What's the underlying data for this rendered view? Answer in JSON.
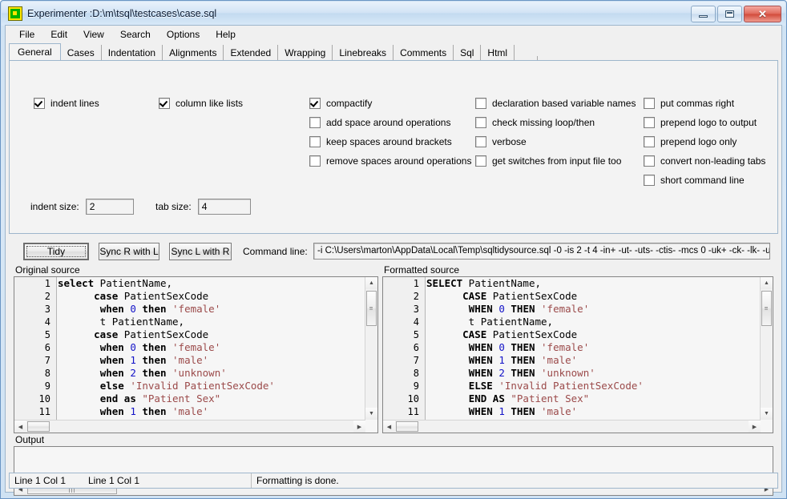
{
  "window": {
    "title": "Experimenter :D:\\m\\tsql\\testcases\\case.sql",
    "icon": "app-icon",
    "minimize_label": "",
    "maximize_label": "",
    "close_label": "✕"
  },
  "menu": {
    "items": [
      "File",
      "Edit",
      "View",
      "Search",
      "Options",
      "Help"
    ]
  },
  "tabs": {
    "active": "General",
    "items": [
      "General",
      "Cases",
      "Indentation",
      "Alignments",
      "Extended",
      "Wrapping",
      "Linebreaks",
      "Comments",
      "Sql",
      "Html"
    ]
  },
  "options": {
    "col1": [
      {
        "label": "indent lines",
        "checked": true
      }
    ],
    "col2": [
      {
        "label": "column like lists",
        "checked": true
      }
    ],
    "col3": [
      {
        "label": "compactify",
        "checked": true
      },
      {
        "label": "add space around operations",
        "checked": false
      },
      {
        "label": "keep spaces around brackets",
        "checked": false
      },
      {
        "label": "remove spaces around operations",
        "checked": false
      }
    ],
    "col4": [
      {
        "label": "declaration based variable names",
        "checked": false
      },
      {
        "label": "check missing loop/then",
        "checked": false
      },
      {
        "label": "verbose",
        "checked": false
      },
      {
        "label": "get switches from input file  too",
        "checked": false
      }
    ],
    "col5": [
      {
        "label": "put commas right",
        "checked": false
      },
      {
        "label": "prepend logo to output",
        "checked": false
      },
      {
        "label": "prepend logo only",
        "checked": false
      },
      {
        "label": "convert non-leading tabs",
        "checked": false
      },
      {
        "label": "short command line",
        "checked": false
      }
    ],
    "indent_size_label": "indent size:",
    "indent_size_value": "2",
    "tab_size_label": "tab size:",
    "tab_size_value": "4"
  },
  "toolbar": {
    "tidy_label": "Tidy",
    "sync_r_with_l_label": "Sync R with L",
    "sync_l_with_r_label": "Sync L with R",
    "command_line_label": "Command line:",
    "command_line_value": "-i C:\\Users\\marton\\AppData\\Local\\Temp\\sqltidysource.sql -0 -is 2 -t 4 -in+ -ut- -uts- -ctis- -mcs 0 -uk+ -ck- -lk- -ui- -c"
  },
  "panes": {
    "original_caption": "Original source",
    "formatted_caption": "Formatted source",
    "original": {
      "line_numbers": [
        "1",
        "2",
        "3",
        "4",
        "5",
        "6",
        "7",
        "8",
        "9",
        "10",
        "11"
      ],
      "lines": [
        [
          {
            "t": "select",
            "c": "kw"
          },
          {
            "t": " PatientName,",
            "c": "pln"
          }
        ],
        [
          {
            "t": "      ",
            "c": "pln"
          },
          {
            "t": "case",
            "c": "kw"
          },
          {
            "t": " PatientSexCode",
            "c": "pln"
          }
        ],
        [
          {
            "t": "       ",
            "c": "pln"
          },
          {
            "t": "when",
            "c": "kw"
          },
          {
            "t": " ",
            "c": "pln"
          },
          {
            "t": "0",
            "c": "num"
          },
          {
            "t": " ",
            "c": "pln"
          },
          {
            "t": "then",
            "c": "kw"
          },
          {
            "t": " ",
            "c": "pln"
          },
          {
            "t": "'female'",
            "c": "str"
          }
        ],
        [
          {
            "t": "       t PatientName,",
            "c": "pln"
          }
        ],
        [
          {
            "t": "      ",
            "c": "pln"
          },
          {
            "t": "case",
            "c": "kw"
          },
          {
            "t": " PatientSexCode",
            "c": "pln"
          }
        ],
        [
          {
            "t": "       ",
            "c": "pln"
          },
          {
            "t": "when",
            "c": "kw"
          },
          {
            "t": " ",
            "c": "pln"
          },
          {
            "t": "0",
            "c": "num"
          },
          {
            "t": " ",
            "c": "pln"
          },
          {
            "t": "then",
            "c": "kw"
          },
          {
            "t": " ",
            "c": "pln"
          },
          {
            "t": "'female'",
            "c": "str"
          }
        ],
        [
          {
            "t": "       ",
            "c": "pln"
          },
          {
            "t": "when",
            "c": "kw"
          },
          {
            "t": " ",
            "c": "pln"
          },
          {
            "t": "1",
            "c": "num"
          },
          {
            "t": " ",
            "c": "pln"
          },
          {
            "t": "then",
            "c": "kw"
          },
          {
            "t": " ",
            "c": "pln"
          },
          {
            "t": "'male'",
            "c": "str"
          }
        ],
        [
          {
            "t": "       ",
            "c": "pln"
          },
          {
            "t": "when",
            "c": "kw"
          },
          {
            "t": " ",
            "c": "pln"
          },
          {
            "t": "2",
            "c": "num"
          },
          {
            "t": " ",
            "c": "pln"
          },
          {
            "t": "then",
            "c": "kw"
          },
          {
            "t": " ",
            "c": "pln"
          },
          {
            "t": "'unknown'",
            "c": "str"
          }
        ],
        [
          {
            "t": "       ",
            "c": "pln"
          },
          {
            "t": "else",
            "c": "kw"
          },
          {
            "t": " ",
            "c": "pln"
          },
          {
            "t": "'Invalid PatientSexCode'",
            "c": "str"
          }
        ],
        [
          {
            "t": "       ",
            "c": "pln"
          },
          {
            "t": "end as",
            "c": "kw"
          },
          {
            "t": " ",
            "c": "pln"
          },
          {
            "t": "\"Patient Sex\"",
            "c": "str"
          }
        ],
        [
          {
            "t": "       ",
            "c": "pln"
          },
          {
            "t": "when",
            "c": "kw"
          },
          {
            "t": " ",
            "c": "pln"
          },
          {
            "t": "1",
            "c": "num"
          },
          {
            "t": " ",
            "c": "pln"
          },
          {
            "t": "then",
            "c": "kw"
          },
          {
            "t": " ",
            "c": "pln"
          },
          {
            "t": "'male'",
            "c": "str"
          }
        ]
      ]
    },
    "formatted": {
      "line_numbers": [
        "1",
        "2",
        "3",
        "4",
        "5",
        "6",
        "7",
        "8",
        "9",
        "10",
        "11"
      ],
      "lines": [
        [
          {
            "t": "SELECT",
            "c": "kw"
          },
          {
            "t": " PatientName,",
            "c": "pln"
          }
        ],
        [
          {
            "t": "      ",
            "c": "pln"
          },
          {
            "t": "CASE",
            "c": "kw"
          },
          {
            "t": " PatientSexCode",
            "c": "pln"
          }
        ],
        [
          {
            "t": "       ",
            "c": "pln"
          },
          {
            "t": "WHEN",
            "c": "kw"
          },
          {
            "t": " ",
            "c": "pln"
          },
          {
            "t": "0",
            "c": "num"
          },
          {
            "t": " ",
            "c": "pln"
          },
          {
            "t": "THEN",
            "c": "kw"
          },
          {
            "t": " ",
            "c": "pln"
          },
          {
            "t": "'female'",
            "c": "str"
          }
        ],
        [
          {
            "t": "       t PatientName,",
            "c": "pln"
          }
        ],
        [
          {
            "t": "      ",
            "c": "pln"
          },
          {
            "t": "CASE",
            "c": "kw"
          },
          {
            "t": " PatientSexCode",
            "c": "pln"
          }
        ],
        [
          {
            "t": "       ",
            "c": "pln"
          },
          {
            "t": "WHEN",
            "c": "kw"
          },
          {
            "t": " ",
            "c": "pln"
          },
          {
            "t": "0",
            "c": "num"
          },
          {
            "t": " ",
            "c": "pln"
          },
          {
            "t": "THEN",
            "c": "kw"
          },
          {
            "t": " ",
            "c": "pln"
          },
          {
            "t": "'female'",
            "c": "str"
          }
        ],
        [
          {
            "t": "       ",
            "c": "pln"
          },
          {
            "t": "WHEN",
            "c": "kw"
          },
          {
            "t": " ",
            "c": "pln"
          },
          {
            "t": "1",
            "c": "num"
          },
          {
            "t": " ",
            "c": "pln"
          },
          {
            "t": "THEN",
            "c": "kw"
          },
          {
            "t": " ",
            "c": "pln"
          },
          {
            "t": "'male'",
            "c": "str"
          }
        ],
        [
          {
            "t": "       ",
            "c": "pln"
          },
          {
            "t": "WHEN",
            "c": "kw"
          },
          {
            "t": " ",
            "c": "pln"
          },
          {
            "t": "2",
            "c": "num"
          },
          {
            "t": " ",
            "c": "pln"
          },
          {
            "t": "THEN",
            "c": "kw"
          },
          {
            "t": " ",
            "c": "pln"
          },
          {
            "t": "'unknown'",
            "c": "str"
          }
        ],
        [
          {
            "t": "       ",
            "c": "pln"
          },
          {
            "t": "ELSE",
            "c": "kw"
          },
          {
            "t": " ",
            "c": "pln"
          },
          {
            "t": "'Invalid PatientSexCode'",
            "c": "str"
          }
        ],
        [
          {
            "t": "       ",
            "c": "pln"
          },
          {
            "t": "END AS",
            "c": "kw"
          },
          {
            "t": " ",
            "c": "pln"
          },
          {
            "t": "\"Patient Sex\"",
            "c": "str"
          }
        ],
        [
          {
            "t": "       ",
            "c": "pln"
          },
          {
            "t": "WHEN",
            "c": "kw"
          },
          {
            "t": " ",
            "c": "pln"
          },
          {
            "t": "1",
            "c": "num"
          },
          {
            "t": " ",
            "c": "pln"
          },
          {
            "t": "THEN",
            "c": "kw"
          },
          {
            "t": " ",
            "c": "pln"
          },
          {
            "t": "'male'",
            "c": "str"
          }
        ]
      ]
    }
  },
  "output": {
    "caption": "Output",
    "text": ""
  },
  "statusbar": {
    "left_position": "Line 1 Col 1",
    "right_position": "Line 1 Col 1",
    "message": "Formatting is done."
  },
  "colors": {
    "keyword": "#000000",
    "number": "#1414c8",
    "string": "#9b4a4a",
    "panel": "#f3f3f3",
    "titlebar": "#cfe2f3",
    "close_button": "#d24a3a"
  }
}
